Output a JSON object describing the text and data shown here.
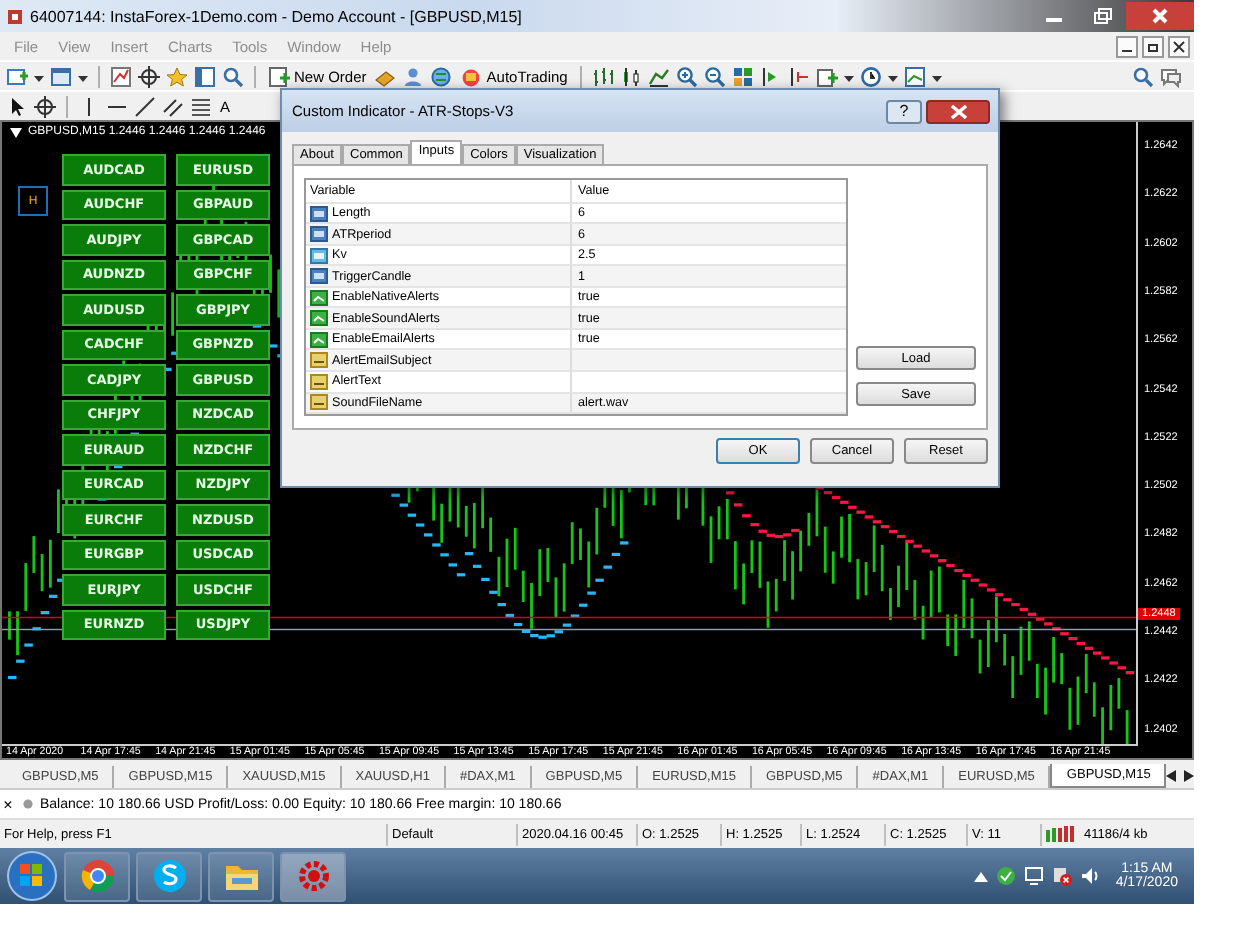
{
  "window": {
    "title": "64007144: InstaForex-1Demo.com - Demo Account - [GBPUSD,M15]"
  },
  "menu": [
    {
      "label": "File",
      "disabled": true
    },
    {
      "label": "View",
      "disabled": true
    },
    {
      "label": "Insert",
      "disabled": true
    },
    {
      "label": "Charts",
      "disabled": true
    },
    {
      "label": "Tools",
      "disabled": true
    },
    {
      "label": "Window",
      "disabled": true
    },
    {
      "label": "Help",
      "disabled": true
    }
  ],
  "toolbar": {
    "new_order": "New Order",
    "autotrading": "AutoTrading",
    "text_tool": "A"
  },
  "chart": {
    "title": "GBPUSD,M15  1.2446 1.2446 1.2446 1.2446",
    "h_button": "H",
    "price_labels": [
      "1.2642",
      "1.2622",
      "1.2602",
      "1.2582",
      "1.2562",
      "1.2542",
      "1.2522",
      "1.2502",
      "1.2482",
      "1.2462",
      "1.2442",
      "1.2422",
      "1.2402"
    ],
    "bid_label": "1.2448",
    "time_labels": [
      "14 Apr 2020",
      "14 Apr 17:45",
      "14 Apr 21:45",
      "15 Apr 01:45",
      "15 Apr 05:45",
      "15 Apr 09:45",
      "15 Apr 13:45",
      "15 Apr 17:45",
      "15 Apr 21:45",
      "16 Apr 01:45",
      "16 Apr 05:45",
      "16 Apr 09:45",
      "16 Apr 13:45",
      "16 Apr 17:45",
      "16 Apr 21:45"
    ],
    "pair_buttons": [
      [
        "AUDCAD",
        "EURUSD"
      ],
      [
        "AUDCHF",
        "GBPAUD"
      ],
      [
        "AUDJPY",
        "GBPCAD"
      ],
      [
        "AUDNZD",
        "GBPCHF"
      ],
      [
        "AUDUSD",
        "GBPJPY"
      ],
      [
        "CADCHF",
        "GBPNZD"
      ],
      [
        "CADJPY",
        "GBPUSD"
      ],
      [
        "CHFJPY",
        "NZDCAD"
      ],
      [
        "EURAUD",
        "NZDCHF"
      ],
      [
        "EURCAD",
        "NZDJPY"
      ],
      [
        "EURCHF",
        "NZDUSD"
      ],
      [
        "EURGBP",
        "USDCAD"
      ],
      [
        "EURJPY",
        "USDCHF"
      ],
      [
        "EURNZD",
        "USDJPY"
      ]
    ]
  },
  "dialog": {
    "title": "Custom Indicator - ATR-Stops-V3",
    "help": "?",
    "tabs": [
      {
        "label": "About",
        "selected": false
      },
      {
        "label": "Common",
        "selected": false
      },
      {
        "label": "Inputs",
        "selected": true
      },
      {
        "label": "Colors",
        "selected": false
      },
      {
        "label": "Visualization",
        "selected": false
      }
    ],
    "columns": [
      "Variable",
      "Value"
    ],
    "rows": [
      {
        "kind": "int",
        "variable": "Length",
        "value": "6"
      },
      {
        "kind": "int",
        "variable": "ATRperiod",
        "value": "6"
      },
      {
        "kind": "double",
        "variable": "Kv",
        "value": "2.5"
      },
      {
        "kind": "int",
        "variable": "TriggerCandle",
        "value": "1"
      },
      {
        "kind": "bool",
        "variable": "EnableNativeAlerts",
        "value": "true"
      },
      {
        "kind": "bool",
        "variable": "EnableSoundAlerts",
        "value": "true"
      },
      {
        "kind": "bool",
        "variable": "EnableEmailAlerts",
        "value": "true"
      },
      {
        "kind": "string",
        "variable": "AlertEmailSubject"
      },
      {
        "kind": "string",
        "variable": "AlertText"
      },
      {
        "kind": "string",
        "variable": "SoundFileName",
        "value": "alert.wav"
      }
    ],
    "side_buttons": [
      "Load",
      "Save"
    ],
    "buttons": [
      "OK",
      "Cancel",
      "Reset"
    ]
  },
  "chart_tabs": [
    {
      "label": "GBPUSD,M5",
      "selected": false
    },
    {
      "label": "GBPUSD,M15",
      "selected": false
    },
    {
      "label": "XAUUSD,M15",
      "selected": false
    },
    {
      "label": "XAUUSD,H1",
      "selected": false
    },
    {
      "label": "#DAX,M1",
      "selected": false
    },
    {
      "label": "GBPUSD,M5",
      "selected": false
    },
    {
      "label": "EURUSD,M15",
      "selected": false
    },
    {
      "label": "GBPUSD,M5",
      "selected": false
    },
    {
      "label": "#DAX,M1",
      "selected": false
    },
    {
      "label": "EURUSD,M5",
      "selected": false
    },
    {
      "label": "GBPUSD,M15",
      "selected": true
    }
  ],
  "terminal": {
    "close": "×",
    "summary": "Balance: 10 180.66 USD  Profit/Loss: 0.00  Equity: 10 180.66  Free margin: 10 180.66"
  },
  "status_bar": [
    "For Help, press F1",
    "Default",
    "2020.04.16 00:45",
    "O: 1.2525",
    "H: 1.2525",
    "L: 1.2524",
    "C: 1.2525",
    "V: 11",
    "41186/4 kb"
  ],
  "taskbar": {
    "time": "1:15 AM",
    "date": "4/17/2020"
  }
}
